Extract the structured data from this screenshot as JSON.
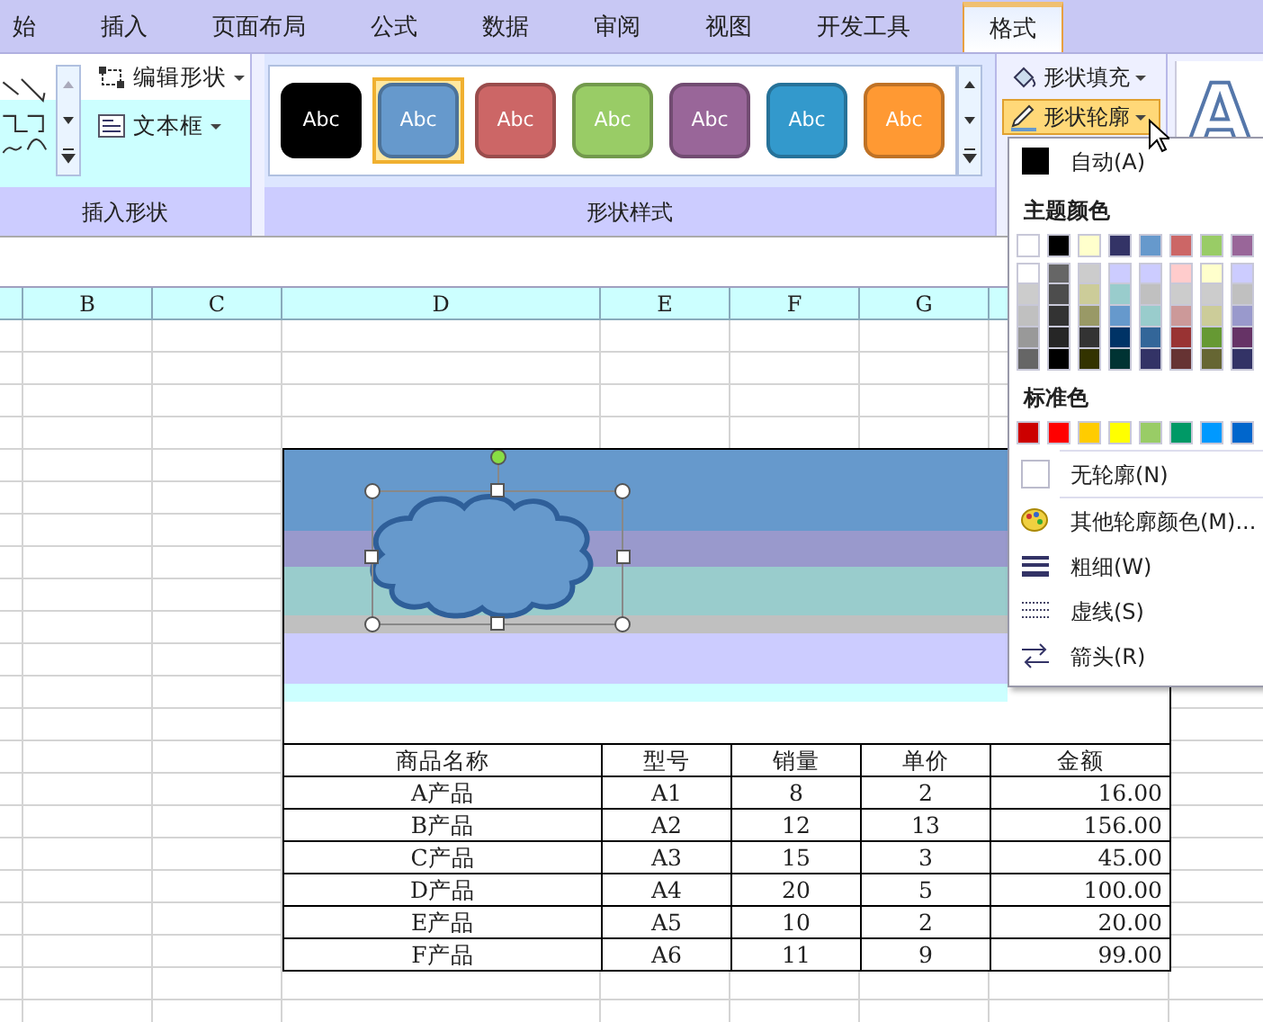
{
  "tabs": [
    {
      "label": "始",
      "selected": false
    },
    {
      "label": "插入",
      "selected": false
    },
    {
      "label": "页面布局",
      "selected": false
    },
    {
      "label": "公式",
      "selected": false
    },
    {
      "label": "数据",
      "selected": false
    },
    {
      "label": "审阅",
      "selected": false
    },
    {
      "label": "视图",
      "selected": false
    },
    {
      "label": "开发工具",
      "selected": false
    },
    {
      "label": "格式",
      "selected": true
    }
  ],
  "ribbon": {
    "insert_shapes": {
      "buttons": [
        {
          "label": "编辑形状",
          "kind": "edit"
        },
        {
          "label": "文本框",
          "kind": "textbox"
        }
      ],
      "group_label": "插入形状"
    },
    "shape_styles": {
      "styles": [
        {
          "label": "Abc",
          "color": "#000000",
          "selected": false
        },
        {
          "label": "Abc",
          "color": "#6699cc",
          "selected": true
        },
        {
          "label": "Abc",
          "color": "#cc6666",
          "selected": false
        },
        {
          "label": "Abc",
          "color": "#99cc66",
          "selected": false
        },
        {
          "label": "Abc",
          "color": "#996699",
          "selected": false
        },
        {
          "label": "Abc",
          "color": "#3399cc",
          "selected": false
        },
        {
          "label": "Abc",
          "color": "#ff9933",
          "selected": false
        }
      ],
      "group_label": "形状样式"
    },
    "format_buttons": [
      {
        "label": "形状填充",
        "kind": "fill",
        "highlighted": false
      },
      {
        "label": "形状轮廓",
        "kind": "outline",
        "highlighted": true
      }
    ],
    "wordart_preview": "A"
  },
  "sheet": {
    "columns": [
      "",
      "B",
      "C",
      "D",
      "E",
      "F",
      "G",
      ""
    ],
    "table": {
      "columns": [
        "商品名称",
        "型号",
        "销量",
        "单价",
        "金额"
      ],
      "rows": [
        [
          "A产品",
          "A1",
          "8",
          "2",
          "16.00"
        ],
        [
          "B产品",
          "A2",
          "12",
          "13",
          "156.00"
        ],
        [
          "C产品",
          "A3",
          "15",
          "3",
          "45.00"
        ],
        [
          "D产品",
          "A4",
          "20",
          "5",
          "100.00"
        ],
        [
          "E产品",
          "A5",
          "10",
          "2",
          "20.00"
        ],
        [
          "F产品",
          "A6",
          "11",
          "9",
          "99.00"
        ]
      ]
    }
  },
  "outline_menu": {
    "auto": {
      "label": "自动(A)",
      "color": "#000000"
    },
    "theme_heading": "主题颜色",
    "theme_colors": [
      {
        "color": "#ffffff",
        "shades": [
          {
            "color": "#ffffff"
          },
          {
            "color": "#cccccc"
          },
          {
            "color": "#c0c0c0"
          },
          {
            "color": "#999999"
          },
          {
            "color": "#666666"
          }
        ]
      },
      {
        "color": "#000000",
        "shades": [
          {
            "color": "#666666"
          },
          {
            "color": "#4d4d4d"
          },
          {
            "color": "#333333"
          },
          {
            "color": "#262626"
          },
          {
            "color": "#000000"
          }
        ]
      },
      {
        "color": "#ffffcc",
        "shades": [
          {
            "color": "#cccccc"
          },
          {
            "color": "#cccc99"
          },
          {
            "color": "#999966"
          },
          {
            "color": "#333333"
          },
          {
            "color": "#333300"
          }
        ]
      },
      {
        "color": "#333366",
        "shades": [
          {
            "color": "#ccccff"
          },
          {
            "color": "#99cccc"
          },
          {
            "color": "#6699cc"
          },
          {
            "color": "#003366"
          },
          {
            "color": "#003333"
          }
        ]
      },
      {
        "color": "#6699cc",
        "shades": [
          {
            "color": "#ccccff"
          },
          {
            "color": "#c0c0c0"
          },
          {
            "color": "#99cccc"
          },
          {
            "color": "#336699"
          },
          {
            "color": "#333366"
          }
        ]
      },
      {
        "color": "#cc6666",
        "shades": [
          {
            "color": "#ffcccc"
          },
          {
            "color": "#cccccc"
          },
          {
            "color": "#cc9999"
          },
          {
            "color": "#993333"
          },
          {
            "color": "#663333"
          }
        ]
      },
      {
        "color": "#99cc66",
        "shades": [
          {
            "color": "#ffffcc"
          },
          {
            "color": "#cccccc"
          },
          {
            "color": "#cccc99"
          },
          {
            "color": "#669933"
          },
          {
            "color": "#666633"
          }
        ]
      },
      {
        "color": "#996699",
        "shades": [
          {
            "color": "#ccccff"
          },
          {
            "color": "#c0c0c0"
          },
          {
            "color": "#9999cc"
          },
          {
            "color": "#663366"
          },
          {
            "color": "#333366"
          }
        ]
      }
    ],
    "standard_heading": "标准色",
    "standard_colors": [
      {
        "color": "#cc0000"
      },
      {
        "color": "#ff0000"
      },
      {
        "color": "#ffcc00"
      },
      {
        "color": "#ffff00"
      },
      {
        "color": "#99cc66"
      },
      {
        "color": "#009966"
      },
      {
        "color": "#0099ff"
      },
      {
        "color": "#0066cc"
      }
    ],
    "items": [
      {
        "label": "无轮廓(N)",
        "kind": "none"
      },
      {
        "label": "其他轮廓颜色(M)...",
        "kind": "more"
      },
      {
        "label": "粗细(W)",
        "kind": "weight"
      },
      {
        "label": "虚线(S)",
        "kind": "dash"
      },
      {
        "label": "箭头(R)",
        "kind": "arrow"
      }
    ]
  }
}
